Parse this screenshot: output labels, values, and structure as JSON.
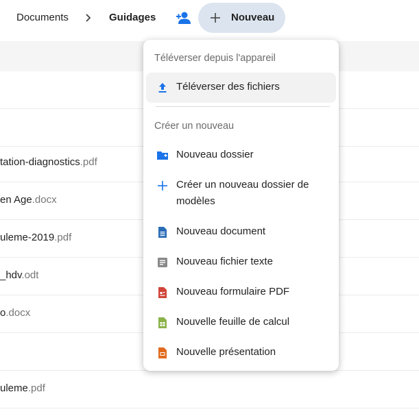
{
  "breadcrumb": {
    "parent": "Documents",
    "current": "Guidages"
  },
  "new_button": {
    "label": "Nouveau"
  },
  "files": [
    {
      "name": "",
      "ext": ""
    },
    {
      "name": "",
      "ext": ""
    },
    {
      "name": "tation-diagnostics",
      "ext": ".pdf"
    },
    {
      "name": "en Age",
      "ext": ".docx"
    },
    {
      "name": "uleme-2019",
      "ext": ".pdf"
    },
    {
      "name": "_hdv",
      "ext": ".odt"
    },
    {
      "name": "o",
      "ext": ".docx"
    },
    {
      "name": "",
      "ext": ""
    },
    {
      "name": "uleme",
      "ext": ".pdf"
    }
  ],
  "menu": {
    "upload_section": "Téléverser depuis l'appareil",
    "upload_files": "Téléverser des fichiers",
    "create_section": "Créer un nouveau",
    "items": {
      "new_folder": "Nouveau dossier",
      "new_template_folder": "Créer un nouveau dossier de modèles",
      "new_document": "Nouveau document",
      "new_text_file": "Nouveau fichier texte",
      "new_pdf_form": "Nouveau formulaire PDF",
      "new_spreadsheet": "Nouvelle feuille de calcul",
      "new_presentation": "Nouvelle présentation"
    }
  },
  "colors": {
    "accent": "#1a73e8",
    "new_button_bg": "#dbe4ef",
    "doc_blue": "#2a6cb6",
    "text_grey": "#8a8a8a",
    "pdf_red": "#d0443a",
    "sheet_green": "#8bb34a",
    "slides_orange": "#e26a1e"
  },
  "icons": {
    "share": "person-add-icon",
    "new": "plus-icon",
    "upload": "upload-icon",
    "folder": "folder-plus-icon",
    "template": "plus-icon",
    "document": "document-icon",
    "text": "text-file-icon",
    "pdf": "pdf-form-icon",
    "sheet": "spreadsheet-icon",
    "slides": "presentation-icon"
  }
}
